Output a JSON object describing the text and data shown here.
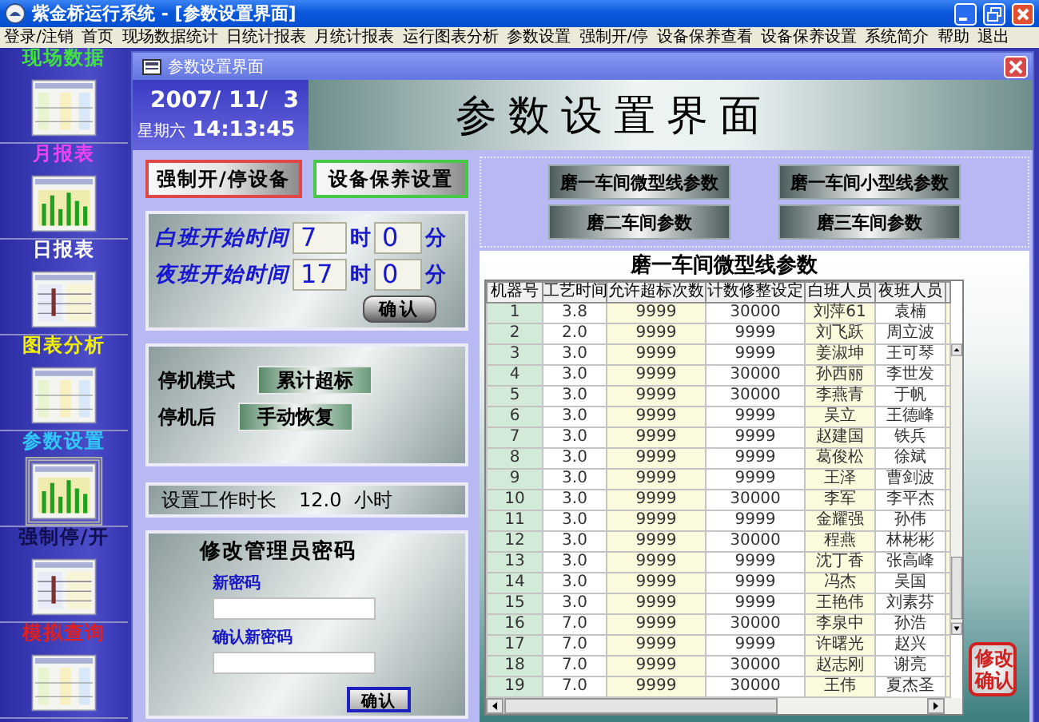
{
  "window": {
    "title": "紫金桥运行系统 - [参数设置界面]"
  },
  "menu": [
    "登录/注销",
    "首页",
    "现场数据统计",
    "日统计报表",
    "月统计报表",
    "运行图表分析",
    "参数设置",
    "强制开/停",
    "设备保养查看",
    "设备保养设置",
    "系统简介",
    "帮助",
    "退出"
  ],
  "sidebar": {
    "items": [
      {
        "label": "现场数据",
        "color": "#40e040",
        "selected": false
      },
      {
        "label": "月报表",
        "color": "#f040f0",
        "selected": false
      },
      {
        "label": "日报表",
        "color": "#ffffff",
        "selected": false
      },
      {
        "label": "图表分析",
        "color": "#f0f000",
        "selected": false
      },
      {
        "label": "参数设置",
        "color": "#30c8f8",
        "selected": true
      },
      {
        "label": "强制停/开",
        "color": "#101050",
        "selected": false
      },
      {
        "label": "模拟查询",
        "color": "#e02020",
        "selected": false
      }
    ]
  },
  "child_window": {
    "title": "参数设置界面"
  },
  "header": {
    "date": "2007/ 11/  3",
    "weekday": "星期六",
    "time": "14:13:45",
    "title": "参数设置界面"
  },
  "left_panel": {
    "buttons": [
      {
        "label": "强制开/停设备",
        "color": "#e04848"
      },
      {
        "label": "设备保养设置",
        "color": "#48c848"
      }
    ],
    "shifts": {
      "rows": [
        {
          "label": "白班开始时间",
          "hour": "7",
          "hour_unit": "时",
          "minute": "0",
          "minute_unit": "分"
        },
        {
          "label": "夜班开始时间",
          "hour": "17",
          "hour_unit": "时",
          "minute": "0",
          "minute_unit": "分"
        }
      ],
      "confirm": "确认"
    },
    "stop": {
      "rows": [
        {
          "label": "停机模式",
          "value": "累计超标"
        },
        {
          "label": "停机后",
          "value": "手动恢复"
        }
      ]
    },
    "work_hours": {
      "label": "设置工作时长",
      "value": "12.0",
      "unit": "小时"
    },
    "password": {
      "title": "修改管理员密码",
      "fields": [
        {
          "label": "新密码"
        },
        {
          "label": "确认新密码"
        }
      ],
      "confirm": "确认"
    }
  },
  "right_panel": {
    "buttons": [
      "磨一车间微型线参数",
      "磨一车间小型线参数",
      "磨二车间参数",
      "磨三车间参数"
    ],
    "table": {
      "title": "磨一车间微型线参数",
      "columns": [
        "机器号",
        "工艺时间",
        "允许超标次数",
        "计数修整设定",
        "白班人员",
        "夜班人员"
      ],
      "rows": [
        [
          "1",
          "3.8",
          "9999",
          "30000",
          "刘萍61",
          "袁楠"
        ],
        [
          "2",
          "2.0",
          "9999",
          "9999",
          "刘飞跃",
          "周立波"
        ],
        [
          "3",
          "3.0",
          "9999",
          "9999",
          "姜淑坤",
          "王可琴"
        ],
        [
          "4",
          "3.0",
          "9999",
          "30000",
          "孙西丽",
          "李世发"
        ],
        [
          "5",
          "3.0",
          "9999",
          "30000",
          "李燕青",
          "于帆"
        ],
        [
          "6",
          "3.0",
          "9999",
          "9999",
          "吴立",
          "王德峰"
        ],
        [
          "7",
          "3.0",
          "9999",
          "9999",
          "赵建国",
          "铁兵"
        ],
        [
          "8",
          "3.0",
          "9999",
          "9999",
          "葛俊松",
          "徐斌"
        ],
        [
          "9",
          "3.0",
          "9999",
          "9999",
          "王泽",
          "曹剑波"
        ],
        [
          "10",
          "3.0",
          "9999",
          "30000",
          "李军",
          "李平杰"
        ],
        [
          "11",
          "3.0",
          "9999",
          "9999",
          "金耀强",
          "孙伟"
        ],
        [
          "12",
          "3.0",
          "9999",
          "30000",
          "程燕",
          "林彬彬"
        ],
        [
          "13",
          "3.0",
          "9999",
          "9999",
          "沈丁香",
          "张高峰"
        ],
        [
          "14",
          "3.0",
          "9999",
          "9999",
          "冯杰",
          "吴国"
        ],
        [
          "15",
          "3.0",
          "9999",
          "9999",
          "王艳伟",
          "刘素芬"
        ],
        [
          "16",
          "7.0",
          "9999",
          "30000",
          "李泉中",
          "孙浩"
        ],
        [
          "17",
          "7.0",
          "9999",
          "9999",
          "许曙光",
          "赵兴"
        ],
        [
          "18",
          "7.0",
          "9999",
          "30000",
          "赵志刚",
          "谢亮"
        ],
        [
          "19",
          "7.0",
          "9999",
          "30000",
          "王伟",
          "夏杰圣"
        ]
      ]
    },
    "save_button": "修改确认"
  }
}
